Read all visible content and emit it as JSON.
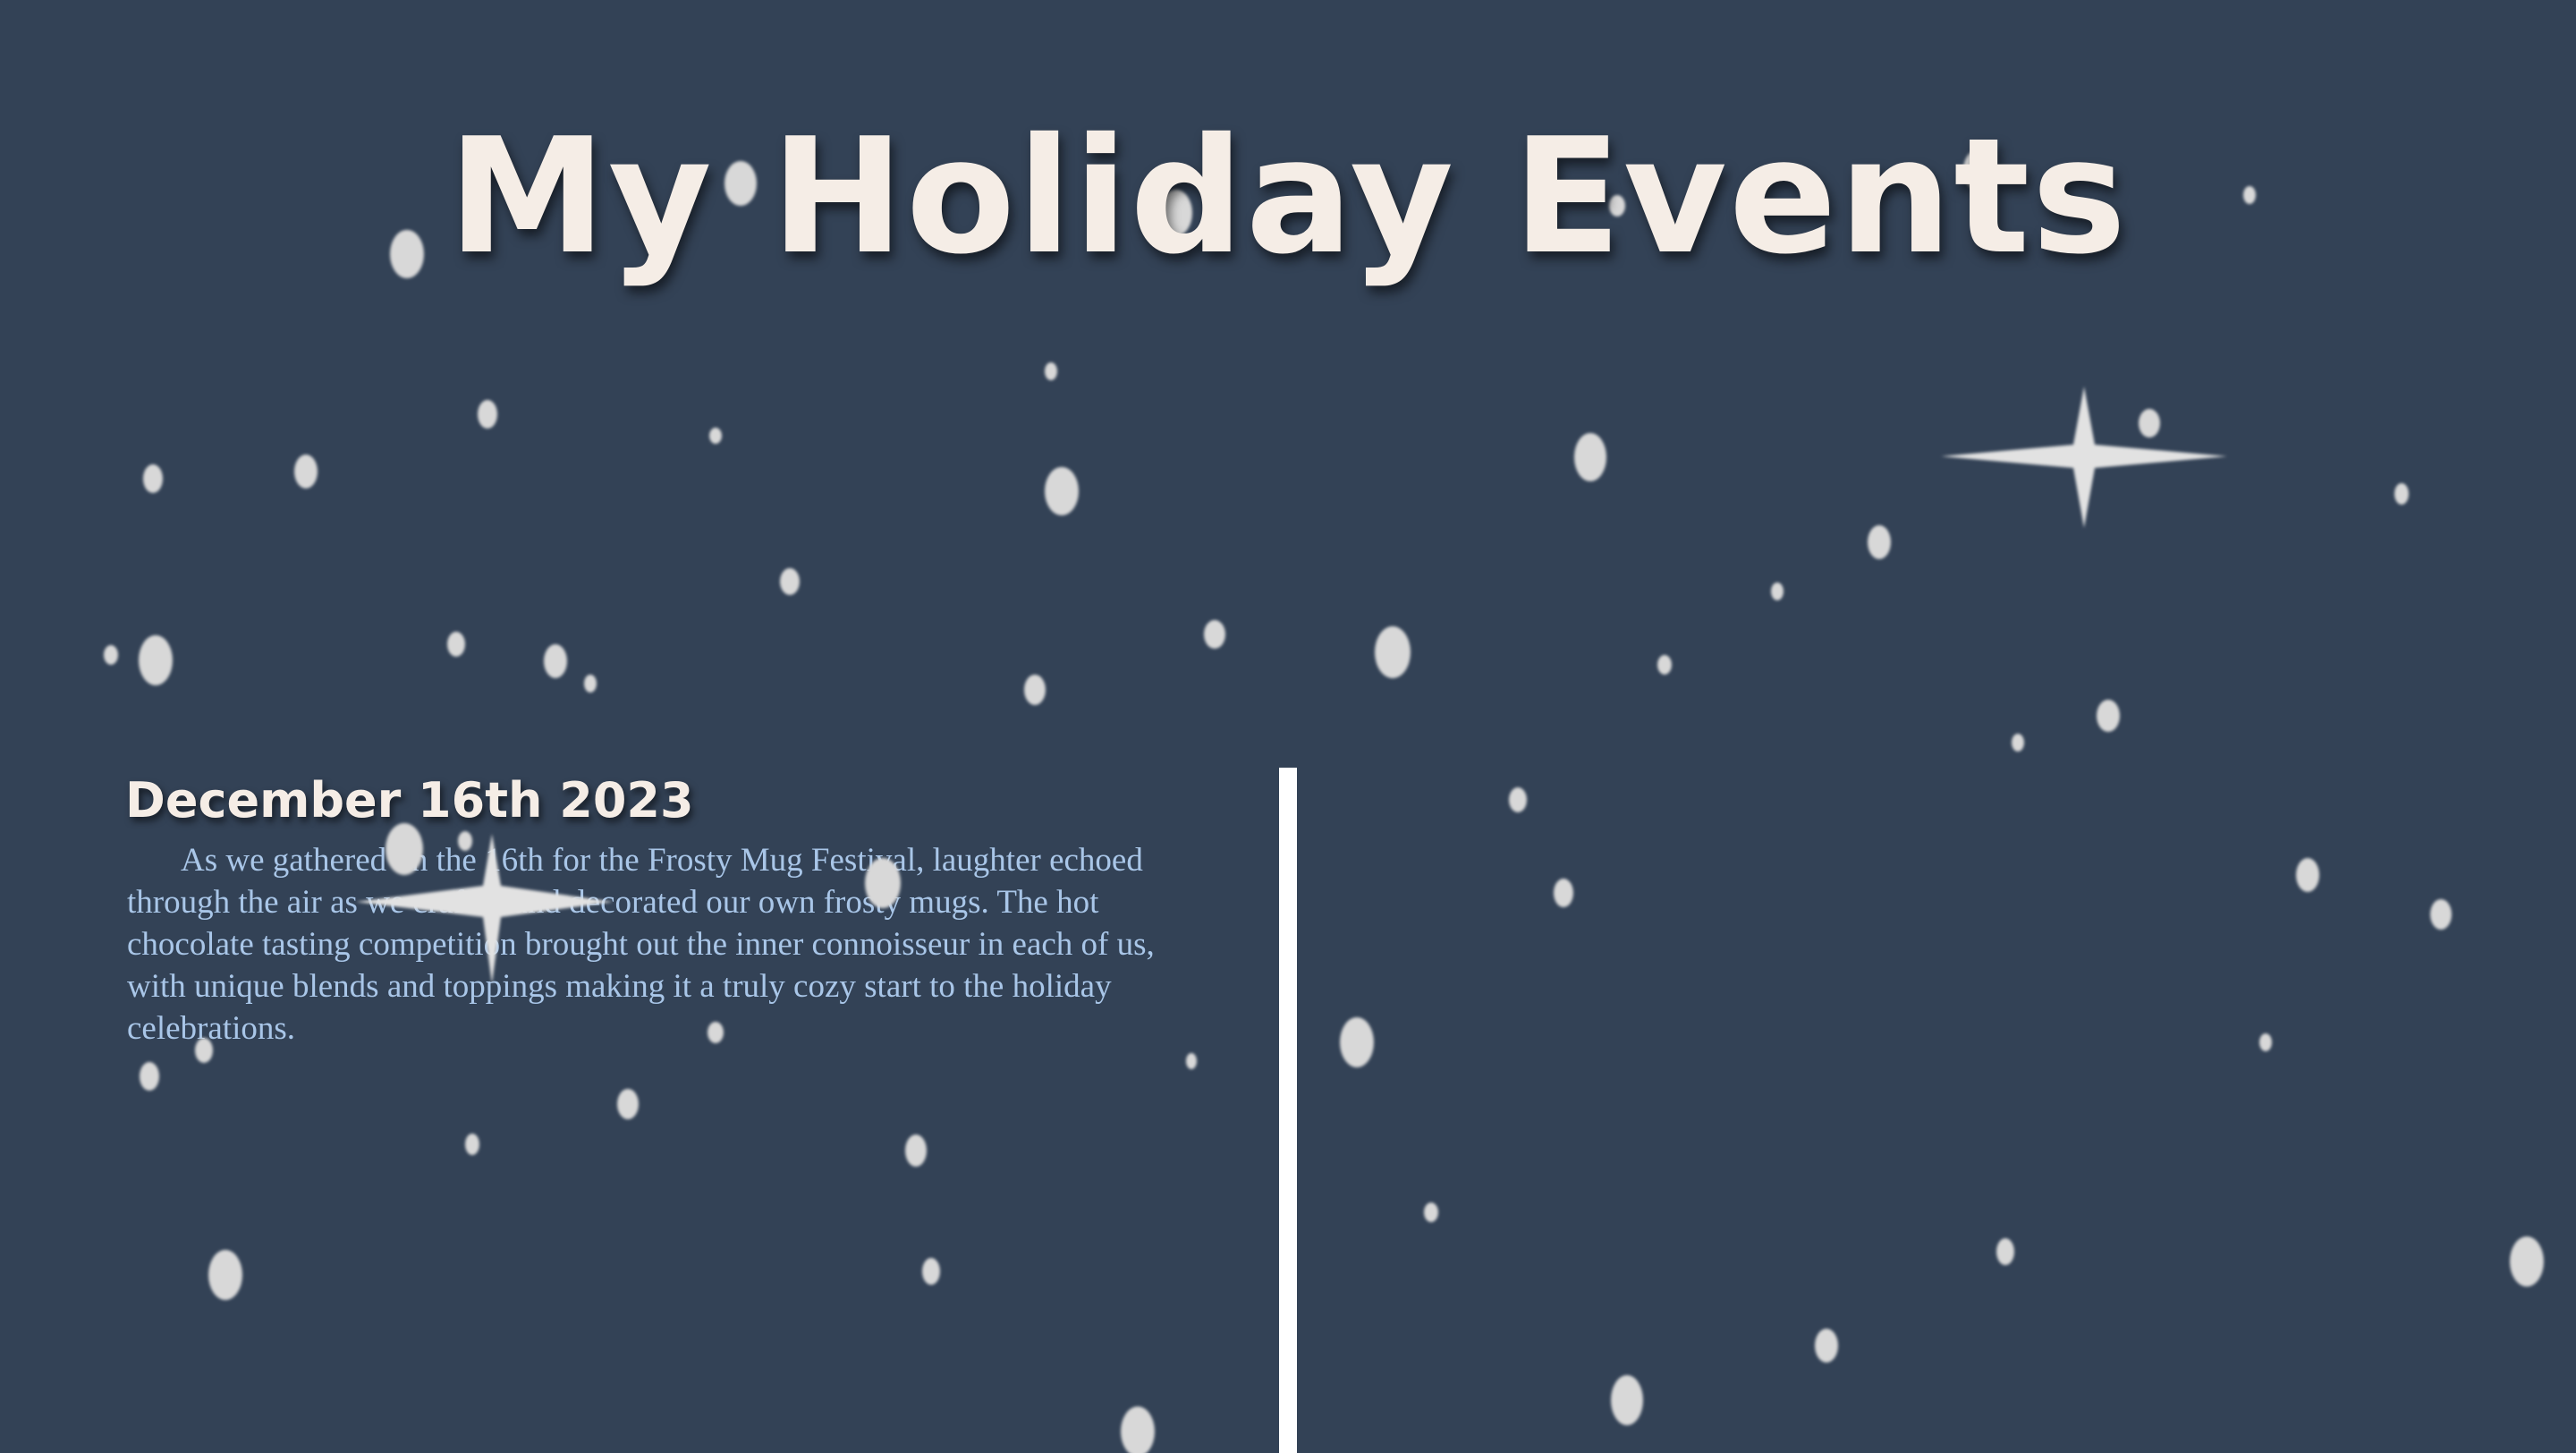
{
  "page": {
    "title": "My Holiday Events"
  },
  "events": [
    {
      "date": "December 16th 2023",
      "description": "As we gathered on the 16th for the Frosty Mug Festival, laughter echoed through the air as we crafted and decorated our own frosty mugs. The hot chocolate tasting competition brought out the inner connoisseur in each of us, with unique blends and toppings making it a truly cozy start to the holiday celebrations."
    }
  ],
  "decorations": {
    "background_color": "#334256",
    "title_color": "#f5ede6",
    "text_color": "#a9c6e8",
    "snowflake_color": "#d8d8d8",
    "divider_color": "#ffffff",
    "icons": [
      "snowflake-icon",
      "sparkle-icon"
    ]
  }
}
